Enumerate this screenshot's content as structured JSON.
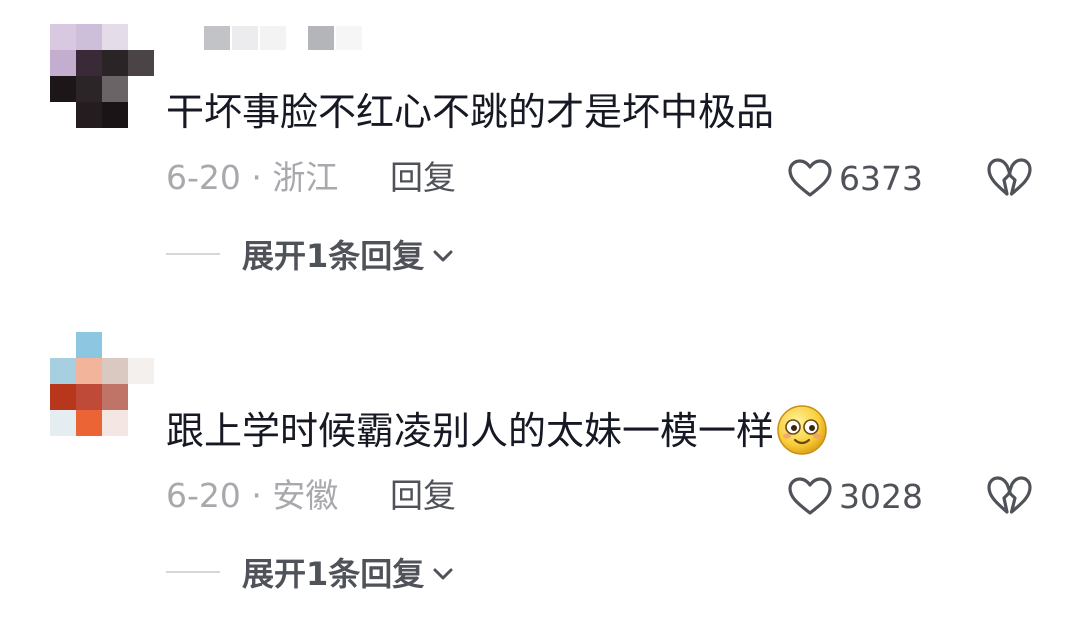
{
  "comments": [
    {
      "text": "干坏事脸不红心不跳的才是坏中极品",
      "meta": "6-20 · 浙江",
      "reply_label": "回复",
      "likes": "6373",
      "expand_label": "展开1条回复"
    },
    {
      "text": "跟上学时候霸凌别人的太妹一模一样",
      "meta": "6-20 · 安徽",
      "reply_label": "回复",
      "likes": "3028",
      "expand_label": "展开1条回复"
    }
  ],
  "icons": {
    "like": "heart-outline-icon",
    "dislike": "broken-heart-icon",
    "expand": "chevron-down-icon",
    "emoji": "smiling-face-emoji"
  },
  "colors": {
    "text": "#161823",
    "meta": "#a8a9ad",
    "action": "#505259"
  }
}
